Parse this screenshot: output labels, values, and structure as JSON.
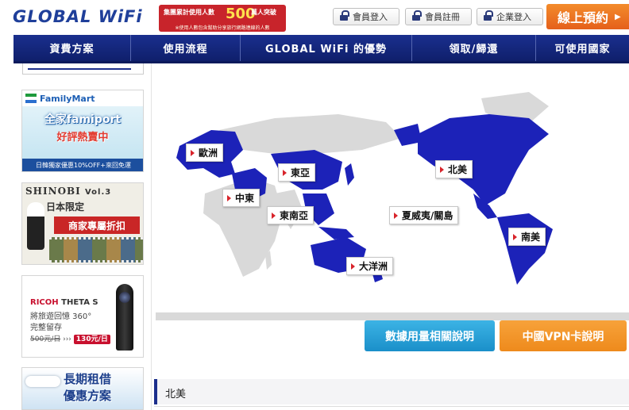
{
  "header": {
    "logo_text": "GLOBAL WiFi",
    "stat_banner": {
      "prefix": "集團累計使用人數",
      "number": "500",
      "suffix": "萬人突破",
      "note": "※使用人數包含幫助分享旅行網路連線的人數"
    },
    "buttons": [
      {
        "label": "會員登入",
        "icon": "lock-icon"
      },
      {
        "label": "會員註冊",
        "icon": "lock-icon"
      },
      {
        "label": "企業登入",
        "icon": "lock-icon"
      }
    ],
    "reserve": "線上預約"
  },
  "nav": [
    {
      "label": "資費方案"
    },
    {
      "label": "使用流程"
    },
    {
      "label": "GLOBAL WiFi 的優勢"
    },
    {
      "label": "領取/歸還"
    },
    {
      "label": "可使用國家"
    }
  ],
  "sidebar_ads": {
    "familymart": {
      "brand": "FamilyMart",
      "title": "全家famiport",
      "hot": "好評熱賣中",
      "bar": "日韓獨家優惠10%OFF+來回免運"
    },
    "shinobi": {
      "title": "SHINOBI",
      "vol": "Vol.3",
      "jp": "日本限定",
      "offer": "商家專屬折扣"
    },
    "ricoh": {
      "brand_red": "RICOH",
      "brand_rest": " THETA S",
      "line1": "將旅遊回憶 360°",
      "line2": "完整留存",
      "old_price": "500",
      "old_unit": "元/日",
      "new_price": "130元/日"
    },
    "long_term": {
      "line1": "長期租借",
      "line2": "優惠方案"
    }
  },
  "map": {
    "land_color": "#d9d9d9",
    "region_color": "#1c22b8",
    "labels": [
      {
        "label": "歐洲"
      },
      {
        "label": "中東"
      },
      {
        "label": "東亞"
      },
      {
        "label": "東南亞"
      },
      {
        "label": "北美"
      },
      {
        "label": "夏威夷/關島"
      },
      {
        "label": "南美"
      },
      {
        "label": "大洋洲"
      }
    ]
  },
  "buttons": {
    "data_usage": "數據用量相關說明",
    "vpn": "中國VPN卡說明"
  },
  "region_bar": {
    "selected": "北美"
  }
}
